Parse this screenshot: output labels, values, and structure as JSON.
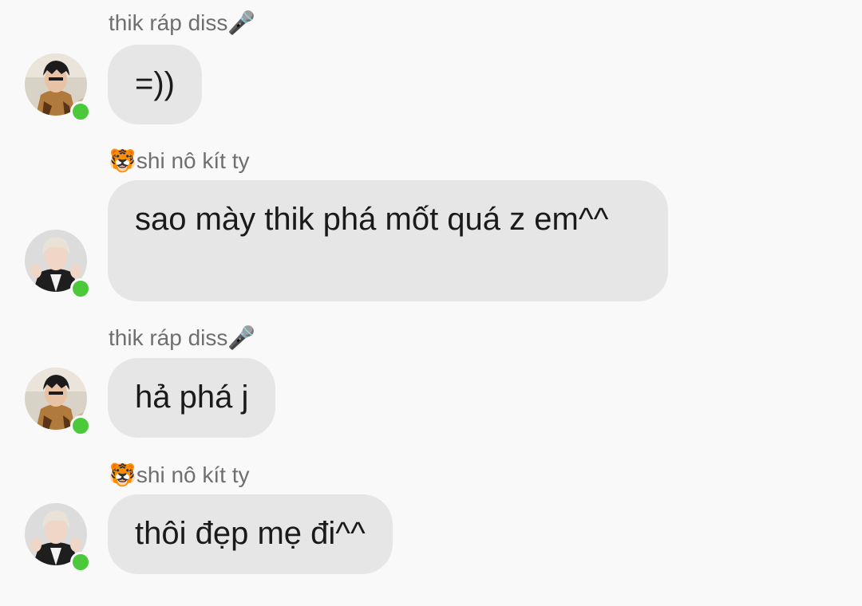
{
  "messages": [
    {
      "sender": "thik ráp diss",
      "sender_emoji_suffix": "🎤",
      "sender_emoji_prefix": "",
      "text": "=))",
      "avatar": "user-a",
      "online": true
    },
    {
      "sender": "shi nô kít ty",
      "sender_emoji_suffix": "",
      "sender_emoji_prefix": "🐯",
      "text": "sao mày thik phá mốt quá z em^^",
      "avatar": "user-b",
      "online": true
    },
    {
      "sender": "thik ráp diss",
      "sender_emoji_suffix": "🎤",
      "sender_emoji_prefix": "",
      "text": "hả phá j",
      "avatar": "user-a",
      "online": true
    },
    {
      "sender": "shi nô kít ty",
      "sender_emoji_suffix": "",
      "sender_emoji_prefix": "🐯",
      "text": "thôi đẹp mẹ đi^^",
      "avatar": "user-b",
      "online": true
    }
  ],
  "colors": {
    "background": "#f9f9f9",
    "bubble": "#e6e6e6",
    "online": "#4cc93b",
    "sender_text": "#6f6f6f"
  }
}
